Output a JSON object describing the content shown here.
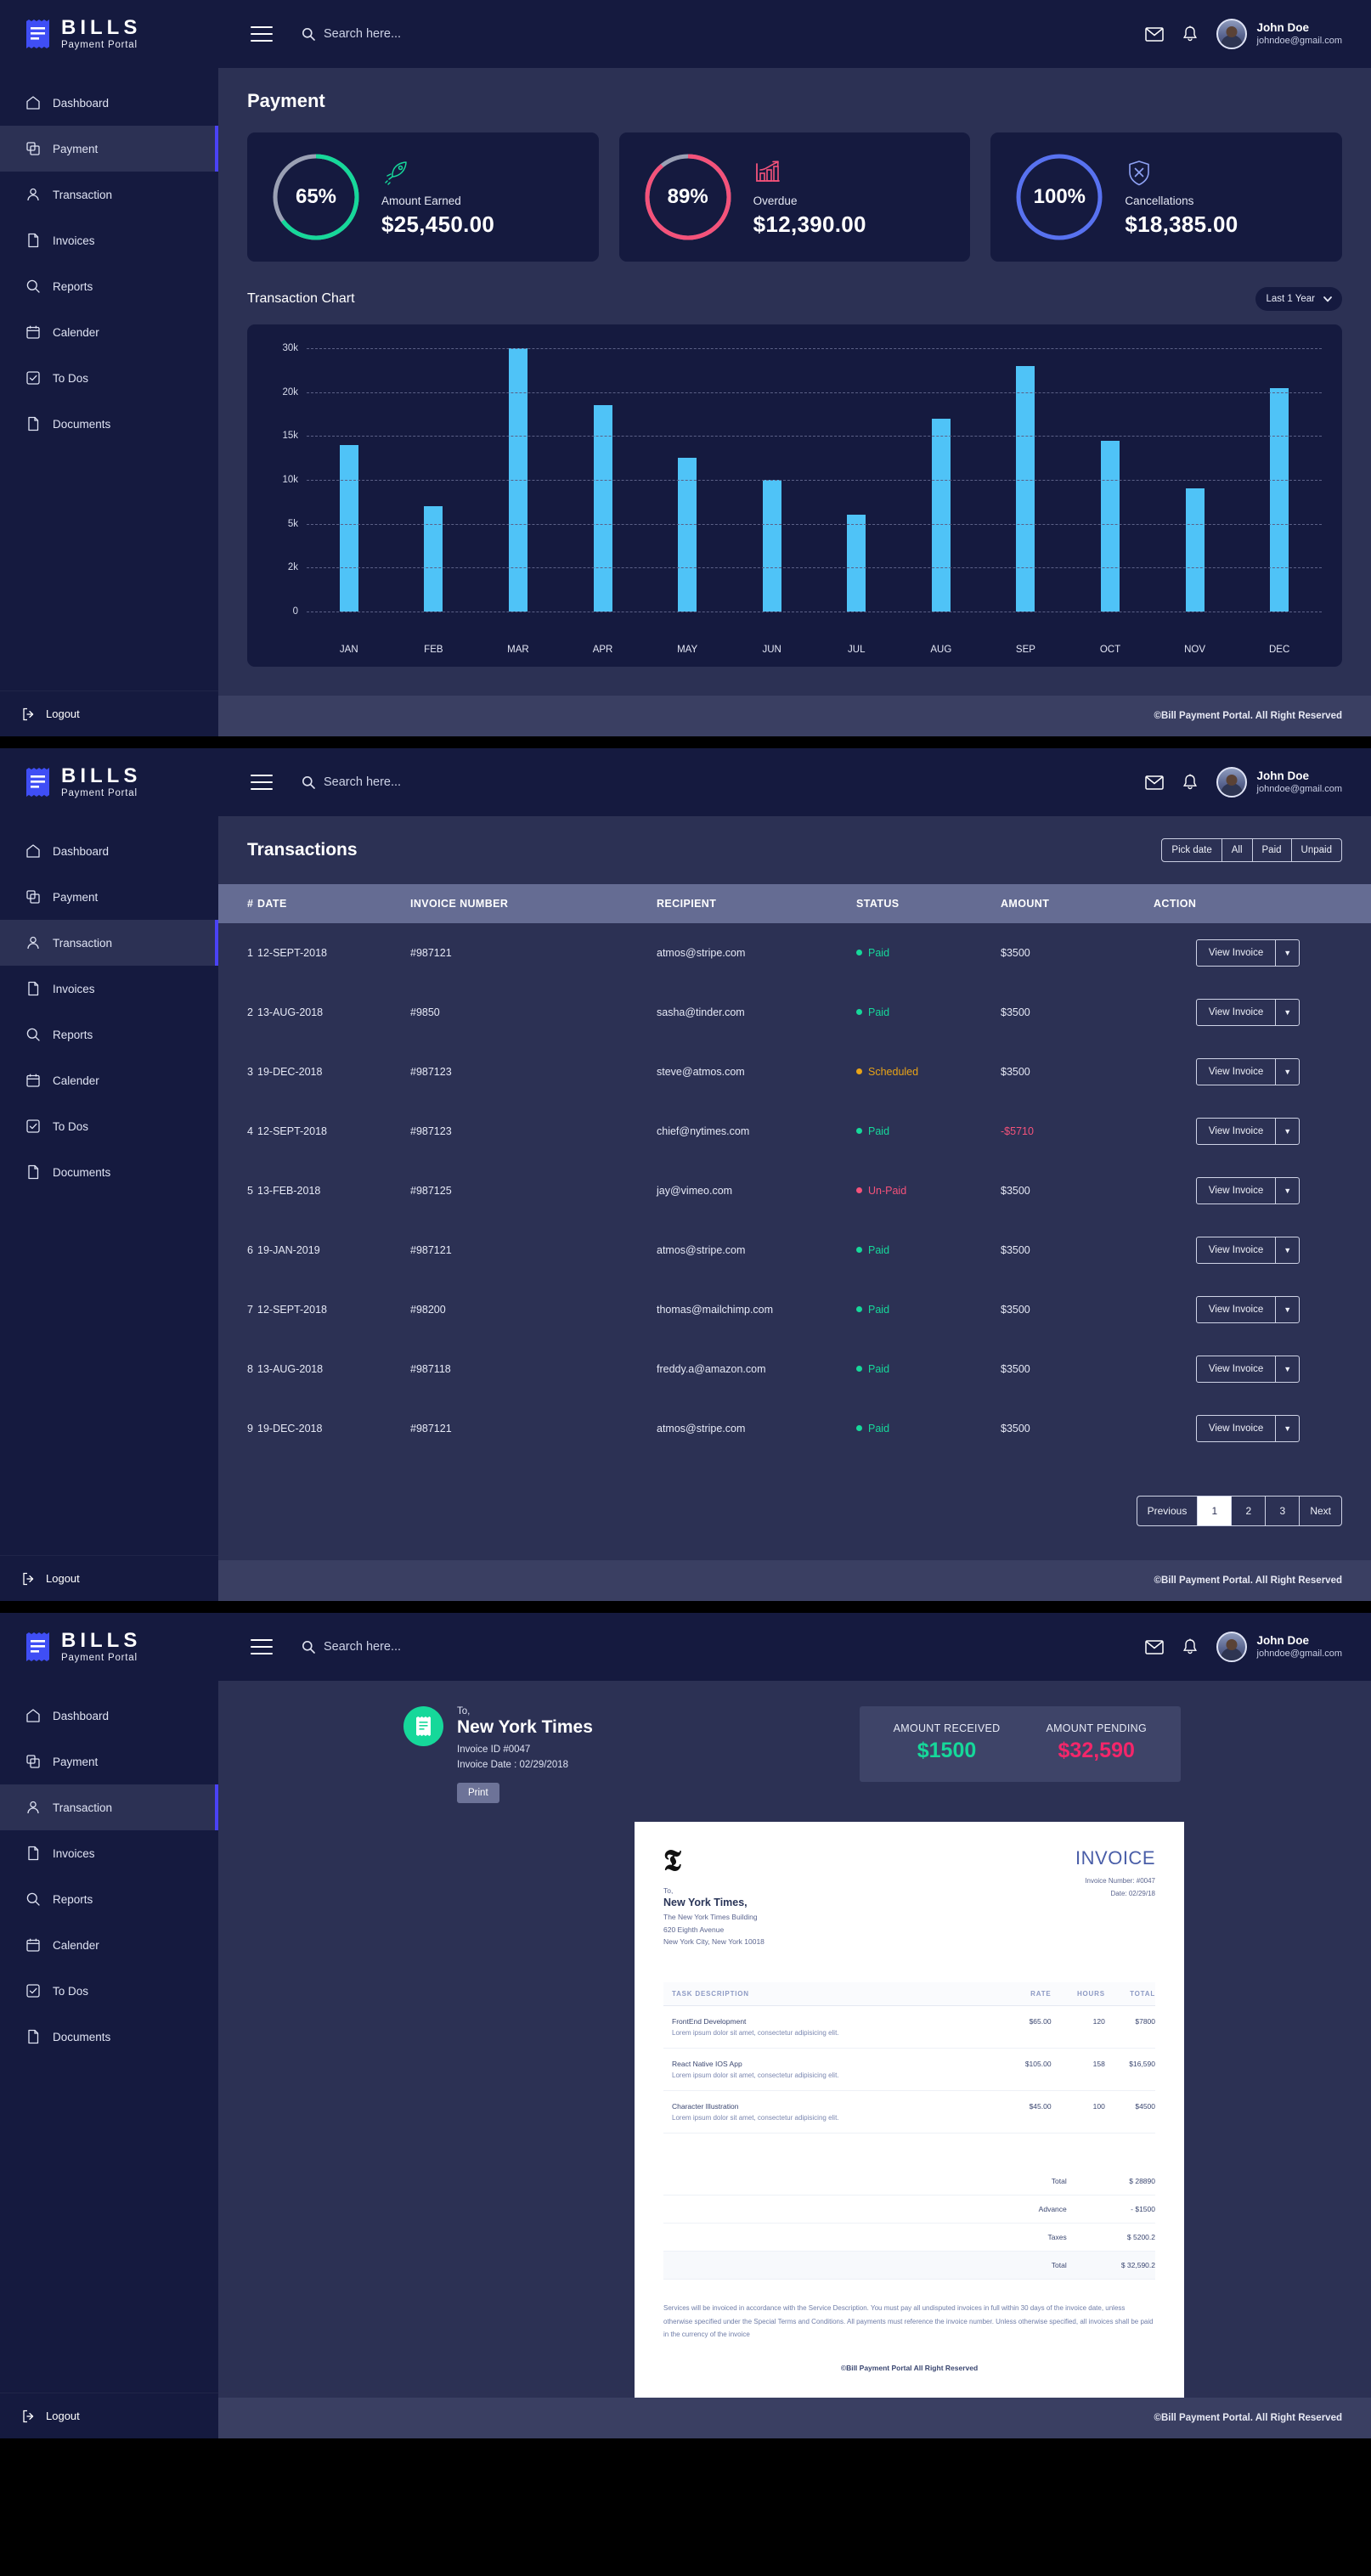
{
  "brand": {
    "title": "BILLS",
    "subtitle": "Payment Portal"
  },
  "search": {
    "placeholder": "Search here..."
  },
  "user": {
    "name": "John Doe",
    "email": "johndoe@gmail.com"
  },
  "sidebar": {
    "items": [
      {
        "label": "Dashboard",
        "icon": "home-icon"
      },
      {
        "label": "Payment",
        "icon": "copy-icon"
      },
      {
        "label": "Transaction",
        "icon": "user-icon"
      },
      {
        "label": "Invoices",
        "icon": "file-icon"
      },
      {
        "label": "Reports",
        "icon": "search-icon"
      },
      {
        "label": "Calender",
        "icon": "calendar-icon"
      },
      {
        "label": "To Dos",
        "icon": "check-square-icon"
      },
      {
        "label": "Documents",
        "icon": "document-icon"
      }
    ],
    "logout": "Logout"
  },
  "footer": {
    "text": "©Bill Payment Portal. All Right Reserved"
  },
  "colors": {
    "green": "#16d89a",
    "pink": "#f4527a",
    "blue": "#5872f0",
    "bar": "#4fc3f7",
    "track": "#9aa0b4",
    "accent": "#4a42f5"
  },
  "screen1": {
    "title": "Payment",
    "cards": [
      {
        "percent": "65%",
        "pct": 65,
        "label": "Amount Earned",
        "value": "$25,450.00",
        "color": "#16d89a",
        "icon": "rocket-icon"
      },
      {
        "percent": "89%",
        "pct": 89,
        "label": "Overdue",
        "value": "$12,390.00",
        "color": "#f4527a",
        "icon": "bar-chart-up-icon"
      },
      {
        "percent": "100%",
        "pct": 100,
        "label": "Cancellations",
        "value": "$18,385.00",
        "color": "#5872f0",
        "icon": "shield-x-icon"
      }
    ],
    "chart_title": "Transaction Chart",
    "range": {
      "label": "Last 1 Year"
    }
  },
  "chart_data": {
    "type": "bar",
    "title": "Transaction Chart",
    "xlabel": "",
    "ylabel": "",
    "grid": true,
    "legend": null,
    "categories": [
      "JAN",
      "FEB",
      "MAR",
      "APR",
      "MAY",
      "JUN",
      "JUL",
      "AUG",
      "SEP",
      "OCT",
      "NOV",
      "DEC"
    ],
    "values": [
      14000,
      7000,
      30000,
      18500,
      12500,
      10000,
      6000,
      17000,
      26000,
      14500,
      9000,
      21000
    ],
    "ytick_labels": [
      "0",
      "2k",
      "5k",
      "10k",
      "15k",
      "20k",
      "30k"
    ],
    "ytick_values": [
      0,
      2000,
      5000,
      10000,
      15000,
      20000,
      30000
    ],
    "ylim": [
      0,
      30000
    ],
    "series": [
      {
        "name": "Transactions",
        "values": [
          14000,
          7000,
          30000,
          18500,
          12500,
          10000,
          6000,
          17000,
          26000,
          14500,
          9000,
          21000
        ]
      }
    ]
  },
  "screen2": {
    "title": "Transactions",
    "filters": [
      "Pick date",
      "All",
      "Paid",
      "Unpaid"
    ],
    "columns": [
      "#",
      "DATE",
      "INVOICE NUMBER",
      "RECIPIENT",
      "STATUS",
      "AMOUNT",
      "ACTION"
    ],
    "action_label": "View Invoice",
    "rows": [
      {
        "idx": "1",
        "date": "12-SEPT-2018",
        "invoice": "#987121",
        "recipient": "atmos@stripe.com",
        "status": "Paid",
        "status_color": "#16d89a",
        "amount": "$3500",
        "amount_color": "#e6e9f6"
      },
      {
        "idx": "2",
        "date": "13-AUG-2018",
        "invoice": "#9850",
        "recipient": "sasha@tinder.com",
        "status": "Paid",
        "status_color": "#16d89a",
        "amount": "$3500",
        "amount_color": "#e6e9f6"
      },
      {
        "idx": "3",
        "date": "19-DEC-2018",
        "invoice": "#987123",
        "recipient": "steve@atmos.com",
        "status": "Scheduled",
        "status_color": "#e8a317",
        "amount": "$3500",
        "amount_color": "#e6e9f6"
      },
      {
        "idx": "4",
        "date": "12-SEPT-2018",
        "invoice": "#987123",
        "recipient": "chief@nytimes.com",
        "status": "Paid",
        "status_color": "#16d89a",
        "amount": "-$5710",
        "amount_color": "#f4527a"
      },
      {
        "idx": "5",
        "date": "13-FEB-2018",
        "invoice": "#987125",
        "recipient": "jay@vimeo.com",
        "status": "Un-Paid",
        "status_color": "#f4527a",
        "amount": "$3500",
        "amount_color": "#e6e9f6"
      },
      {
        "idx": "6",
        "date": "19-JAN-2019",
        "invoice": "#987121",
        "recipient": "atmos@stripe.com",
        "status": "Paid",
        "status_color": "#16d89a",
        "amount": "$3500",
        "amount_color": "#e6e9f6"
      },
      {
        "idx": "7",
        "date": "12-SEPT-2018",
        "invoice": "#98200",
        "recipient": "thomas@mailchimp.com",
        "status": "Paid",
        "status_color": "#16d89a",
        "amount": "$3500",
        "amount_color": "#e6e9f6"
      },
      {
        "idx": "8",
        "date": "13-AUG-2018",
        "invoice": "#987118",
        "recipient": "freddy.a@amazon.com",
        "status": "Paid",
        "status_color": "#16d89a",
        "amount": "$3500",
        "amount_color": "#e6e9f6"
      },
      {
        "idx": "9",
        "date": "19-DEC-2018",
        "invoice": "#987121",
        "recipient": "atmos@stripe.com",
        "status": "Paid",
        "status_color": "#16d89a",
        "amount": "$3500",
        "amount_color": "#e6e9f6"
      }
    ],
    "pagination": {
      "previous": "Previous",
      "pages": [
        "1",
        "2",
        "3"
      ],
      "current": "1",
      "next": "Next"
    }
  },
  "screen3": {
    "to_label": "To,",
    "company": "New York Times",
    "invoice_id": "Invoice ID #0047",
    "invoice_date": "Invoice Date : 02/29/2018",
    "print": "Print",
    "received_label": "AMOUNT RECEIVED",
    "received_value": "$1500",
    "pending_label": "AMOUNT PENDING",
    "pending_value": "$32,590",
    "paper": {
      "logo": "𝕿",
      "to_label": "To,",
      "company": "New York Times,",
      "address": [
        "The New York Times Building",
        "620 Eighth Avenue",
        "New York City, New York 10018"
      ],
      "heading": "INVOICE",
      "number": "Invoice Number: #0047",
      "date": "Date: 02/29/18",
      "columns": [
        "TASK DESCRIPTION",
        "RATE",
        "HOURS",
        "TOTAL"
      ],
      "items": [
        {
          "name": "FrontEnd Development",
          "desc": "Lorem ipsum dolor sit amet, consectetur adipisicing elit.",
          "rate": "$65.00",
          "hours": "120",
          "total": "$7800"
        },
        {
          "name": "React Native IOS App",
          "desc": "Lorem ipsum dolor sit amet, consectetur adipisicing elit.",
          "rate": "$105.00",
          "hours": "158",
          "total": "$16,590"
        },
        {
          "name": "Character Illustration",
          "desc": "Lorem ipsum dolor sit amet, consectetur adipisicing elit.",
          "rate": "$45.00",
          "hours": "100",
          "total": "$4500"
        }
      ],
      "summary": [
        {
          "label": "Total",
          "value": "$ 28890"
        },
        {
          "label": "Advance",
          "value": "- $1500"
        },
        {
          "label": "Taxes",
          "value": "$ 5200.2"
        },
        {
          "label": "Total",
          "value": "$ 32,590.2"
        }
      ],
      "terms": "Services will be invoiced in accordance with the Service Description. You must pay all undisputed invoices in full within 30 days of the invoice date, unless otherwise specified under the Special Terms and Conditions. All payments must reference the invoice number. Unless otherwise specified, all invoices shall be paid in the currency of the invoice",
      "footer": "©Bill Payment Portal All Right Reserved"
    }
  }
}
